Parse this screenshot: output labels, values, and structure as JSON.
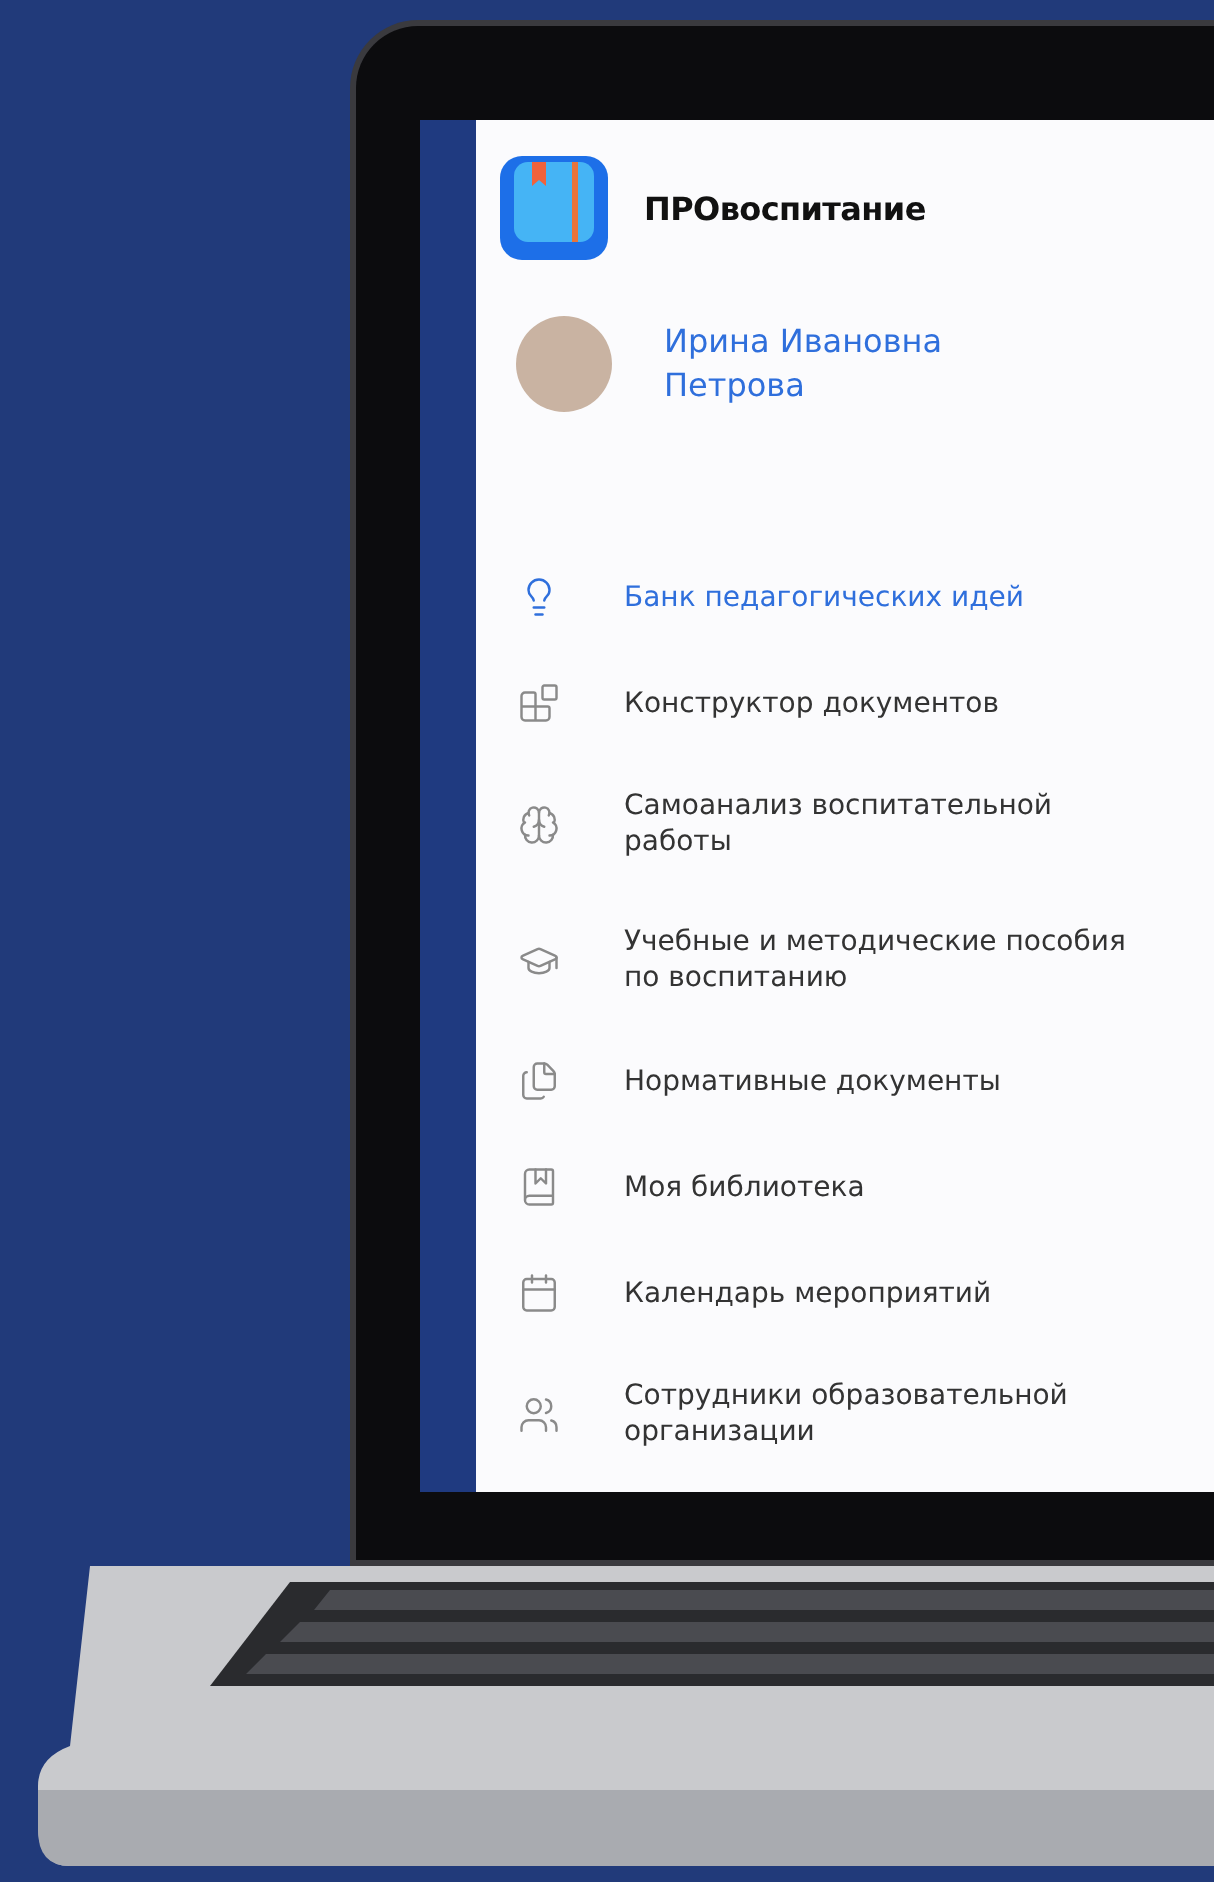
{
  "app": {
    "title": "ПРОвоспитание"
  },
  "profile": {
    "name": "Ирина Ивановна Петрова"
  },
  "menu": [
    {
      "label": "Банк педагогических идей",
      "selected": true
    },
    {
      "label": "Конструктор документов",
      "selected": false
    },
    {
      "label": "Самоанализ воспитательной работы",
      "selected": false
    },
    {
      "label": "Учебные и методические пособия по воспитанию",
      "selected": false
    },
    {
      "label": "Нормативные документы",
      "selected": false
    },
    {
      "label": "Моя библиотека",
      "selected": false
    },
    {
      "label": "Календарь мероприятий",
      "selected": false
    },
    {
      "label": "Сотрудники образовательной организации",
      "selected": false
    }
  ]
}
